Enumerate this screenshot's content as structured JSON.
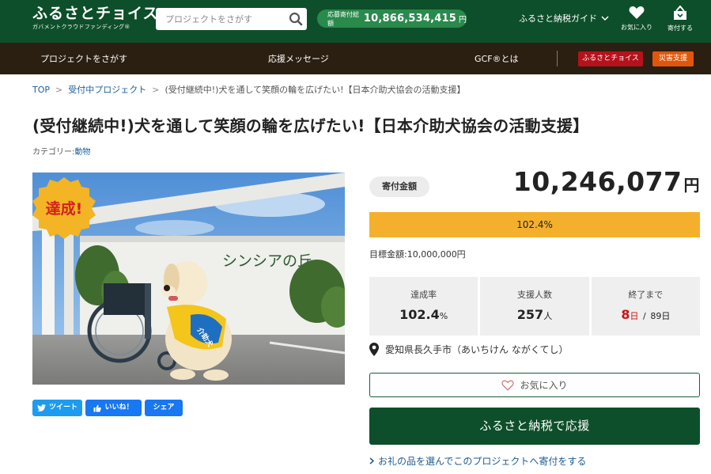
{
  "header": {
    "logo_main": "ふるさとチョイス",
    "logo_sub": "ガバメントクラウドファンディング®",
    "search_placeholder": "プロジェクトをさがす",
    "total_label": "応募寄付総額",
    "total_value": "10,866,534,415",
    "total_unit": "円",
    "guide_label": "ふるさと納税ガイド",
    "favorites_label": "お気に入り",
    "donate_label": "寄付する"
  },
  "nav": {
    "find_projects": "プロジェクトをさがす",
    "messages": "応援メッセージ",
    "gcf_about": "GCF®とは",
    "furusato_badge": "ふるさとチョイス",
    "disaster_badge": "災害支援"
  },
  "breadcrumb": {
    "top": "TOP",
    "sep": ">",
    "accepting": "受付中プロジェクト",
    "current": "(受付継続中!)犬を通して笑顔の輪を広げたい!【日本介助犬協会の活動支援】"
  },
  "project": {
    "title": "(受付継続中!)犬を通して笑顔の輪を広げたい!【日本介助犬協会の活動支援】",
    "category_label": "カテゴリー:",
    "category_value": "動物",
    "achieved_badge": "達成!",
    "sign_text": "シンシアの丘",
    "vest_text": "介助犬"
  },
  "share": {
    "tweet": "ツイート",
    "like": "いいね！",
    "share": "シェア"
  },
  "donation": {
    "label": "寄付金額",
    "amount": "10,246,077",
    "unit": "円",
    "progress_text": "102.4%",
    "progress_fraction": 1.0,
    "target": "目標金額:10,000,000円"
  },
  "stats": {
    "rate_label": "達成率",
    "rate_value": "102.4",
    "rate_unit": "%",
    "supporters_label": "支援人数",
    "supporters_value": "257",
    "supporters_unit": "人",
    "remaining_label": "終了まで",
    "remaining_days": "8",
    "remaining_unit": "日",
    "remaining_sep": "/",
    "total_days": "89日"
  },
  "location": "愛知県長久手市（あいちけん ながくてし）",
  "buttons": {
    "favorite": "お気に入り",
    "support": "ふるさと納税で応援",
    "gift_link": "お礼の品を選んでこのプロジェクトへ寄付をする"
  },
  "colors": {
    "header_green": "#0d4f2a",
    "nav_brown": "#2b1f11",
    "progress_orange": "#f4b02c",
    "badge_red": "#b5121b",
    "badge_orange": "#e0570b",
    "twitter_blue": "#1d9bf0",
    "facebook_blue": "#1877f2"
  }
}
